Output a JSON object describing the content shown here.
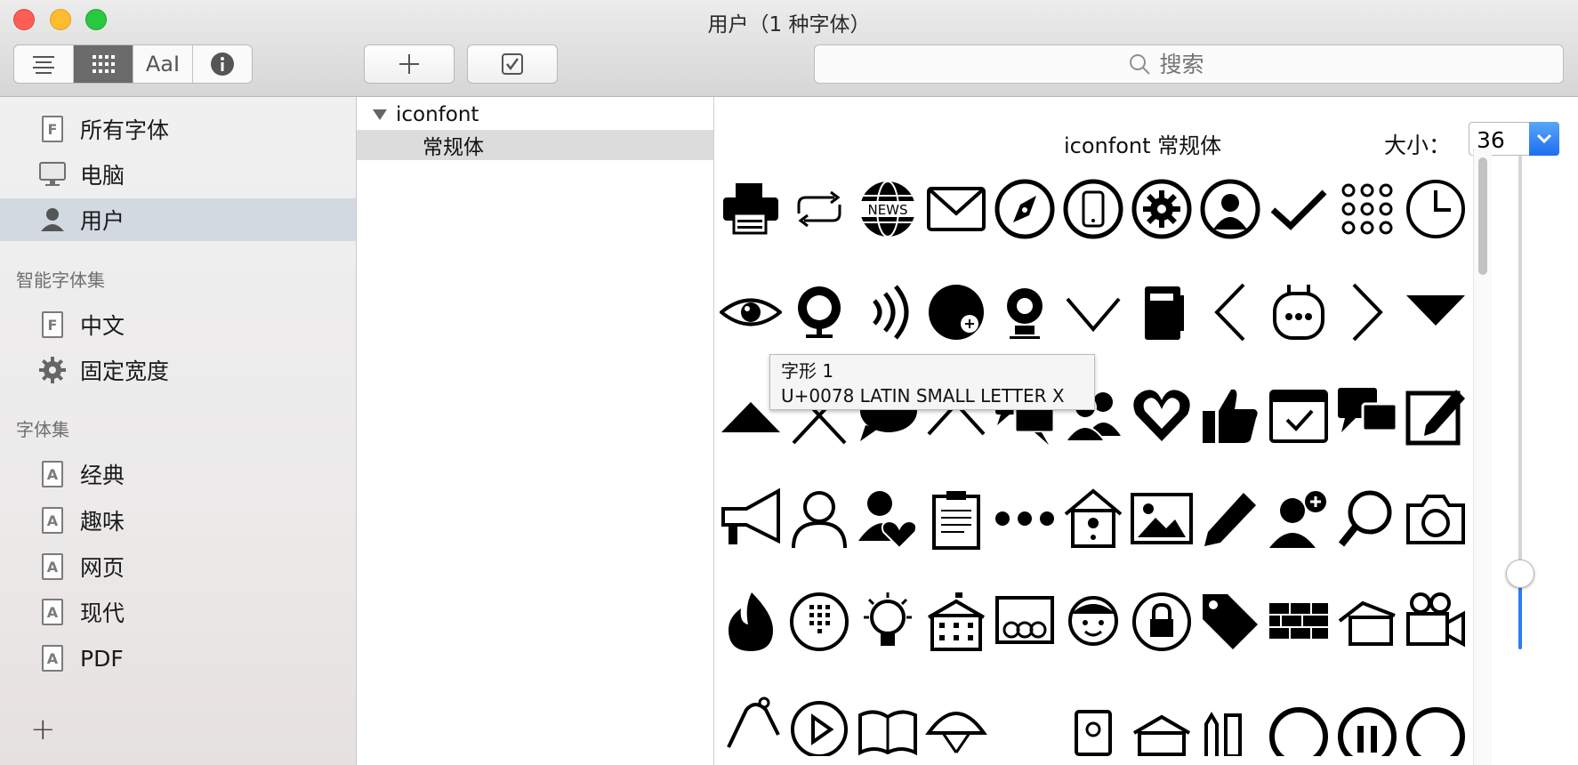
{
  "window": {
    "title": "用户（1 种字体）"
  },
  "toolbar": {
    "view_buttons": [
      "list-view",
      "grid-view",
      "sample-view",
      "info-view"
    ],
    "sample_label": "AaI",
    "add_label": "+",
    "search_placeholder": "搜索"
  },
  "sidebar": {
    "items": [
      {
        "label": "所有字体",
        "icon": "font-doc-icon"
      },
      {
        "label": "电脑",
        "icon": "computer-icon"
      },
      {
        "label": "用户",
        "icon": "user-icon",
        "selected": true
      }
    ],
    "smart_header": "智能字体集",
    "smart_items": [
      {
        "label": "中文",
        "icon": "font-doc-icon"
      },
      {
        "label": "固定宽度",
        "icon": "gear-icon"
      }
    ],
    "collections_header": "字体集",
    "collections": [
      {
        "label": "经典"
      },
      {
        "label": "趣味"
      },
      {
        "label": "网页"
      },
      {
        "label": "现代"
      },
      {
        "label": "PDF"
      }
    ],
    "add_label": "+"
  },
  "families": {
    "family": "iconfont",
    "style": "常规体"
  },
  "preview": {
    "title": "iconfont 常规体",
    "size_label": "大小：",
    "size_value": "36",
    "tooltip_line1": "字形 1",
    "tooltip_line2": "U+0078 LATIN SMALL LETTER X",
    "news_text": "NEWS",
    "colors": {
      "accent": "#2f7cf6",
      "selection": "#d3d9e1"
    }
  }
}
